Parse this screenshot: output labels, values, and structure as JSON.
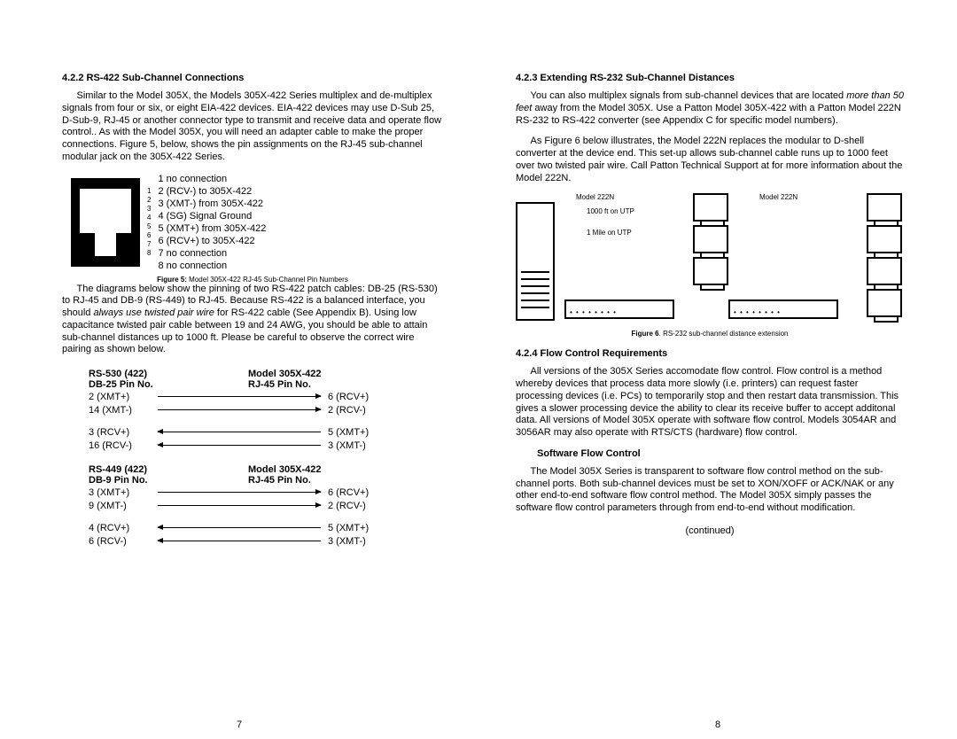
{
  "left": {
    "h1": "4.2.2  RS-422 Sub-Channel Connections",
    "p1a": "Similar to the Model 305X, the Models 305X-422 Series multiplex and de-multiplex signals from four or six, or eight EIA-422 devices. EIA-422 devices may use D-Sub 25, D-Sub-9, RJ-45 or another connector type to transmit and receive data and operate flow control.. As with the Model 305X, you will need an adapter cable to make the proper connections.  Figure 5, below, shows the pin assignments on the RJ-45 sub-channel modular jack on the 305X-422 Series.",
    "pins": [
      "1 no connection",
      "2 (RCV-) to 305X-422",
      "3 (XMT-) from 305X-422",
      "4 (SG) Signal Ground",
      "5 (XMT+) from 305X-422",
      "6 (RCV+) to 305X-422",
      "7 no connection",
      "8 no connection"
    ],
    "fig5b": "Figure 5:",
    "fig5": "  Model 305X-422 RJ-45 Sub-Channel Pin Numbers",
    "p2a": "The diagrams below show the pinning of two RS-422 patch cables: DB-25 (RS-530) to RJ-45 and DB-9 (RS-449) to RJ-45.  Because RS-422 is a balanced interface, you should ",
    "p2i": "always use twisted pair wire",
    "p2b": " for RS-422 cable (See Appendix B).  Using low capacitance twisted pair cable between 19 and 24 AWG, you should be able to attain sub-channel distances up to 1000 ft.  Please be careful to observe the correct wire pairing as shown below.",
    "t1": {
      "hL1": "RS-530 (422)",
      "hR1": "Model 305X-422",
      "hL2": "DB-25 Pin No.",
      "hR2": "RJ-45 Pin No.",
      "rows": [
        {
          "l": "2 (XMT+)",
          "dir": "r",
          "r": "6 (RCV+)"
        },
        {
          "l": "14 (XMT-)",
          "dir": "r",
          "r": "2 (RCV-)"
        },
        {
          "gap": true
        },
        {
          "l": "3 (RCV+)",
          "dir": "l",
          "r": "5 (XMT+)"
        },
        {
          "l": "16 (RCV-)",
          "dir": "l",
          "r": "3 (XMT-)"
        }
      ]
    },
    "t2": {
      "hL1": "RS-449 (422)",
      "hR1": "Model 305X-422",
      "hL2": "DB-9 Pin No.",
      "hR2": "RJ-45 Pin No.",
      "rows": [
        {
          "l": "3 (XMT+)",
          "dir": "r",
          "r": "6 (RCV+)"
        },
        {
          "l": "9 (XMT-)",
          "dir": "r",
          "r": "2 (RCV-)"
        },
        {
          "gap": true
        },
        {
          "l": "4 (RCV+)",
          "dir": "l",
          "r": "5 (XMT+)"
        },
        {
          "l": "6 (RCV-)",
          "dir": "l",
          "r": "3 (XMT-)"
        }
      ]
    },
    "pagenum": "7"
  },
  "right": {
    "h1": "4.2.3  Extending RS-232 Sub-Channel Distances",
    "p1a": "You can also multiplex signals from sub-channel devices that are located ",
    "p1i": "more than 50 feet",
    "p1b": " away from the Model 305X.  Use a Patton Model 305X-422 with a Patton Model 222N RS-232 to RS-422 converter (see Appendix C for specific model numbers).",
    "p2": "As Figure 6 below illustrates, the Model 222N replaces the modular to D-shell converter at the device end.  This set-up allows sub-channel cable runs up to 1000 feet over two twisted pair wire.  Call Patton Technical Support at  for more information about the Model 222N.",
    "f6l1": "Model 222N",
    "f6l2": "Model 222N",
    "f6l3": "1000 ft on UTP",
    "f6l4": "1 Mile on UTP",
    "fig6b": "Figure 6",
    "fig6": ". RS-232 sub-channel distance extension",
    "h2": "4.2.4  Flow Control Requirements",
    "p3": "All versions of the 305X Series accomodate flow control.  Flow control is a method whereby devices that process data more slowly (i.e. printers) can request faster processing devices (i.e. PCs) to temporarily stop and then restart data transmission.  This gives a slower processing device the ability to clear its receive buffer to accept additonal data.  All versions of Model 305X operate with software flow control.  Models 3054AR and 3056AR may also operate with RTS/CTS (hardware) flow control.",
    "h3": "Software Flow Control",
    "p4": "The Model 305X Series is transparent to software flow control method on the sub-channel ports.  Both sub-channel devices must be set to XON/XOFF or ACK/NAK or any other end-to-end software flow control method.  The Model 305X simply passes the software flow control parameters through from end-to-end without modification.",
    "continued": "(continued)",
    "pagenum": "8"
  }
}
